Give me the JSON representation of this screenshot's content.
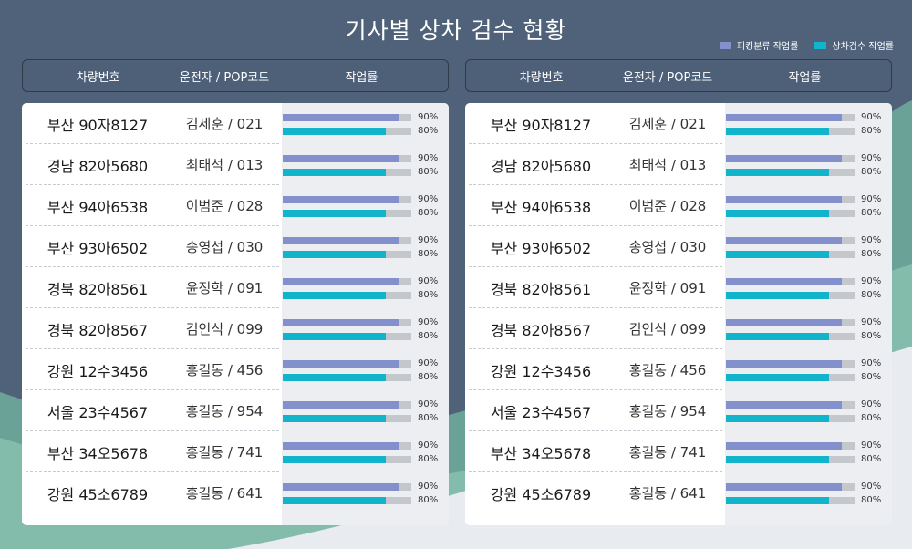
{
  "title": "기사별 상차 검수 현황",
  "legend": {
    "items": [
      {
        "label": "피킹분류 작업률",
        "color": "#8490cc"
      },
      {
        "label": "상차검수 작업률",
        "color": "#12b4cc"
      }
    ]
  },
  "columns": {
    "plate": "차량번호",
    "driver": "운전자 / POP코드",
    "rate": "작업률"
  },
  "panels": [
    {
      "rows": [
        {
          "plate": "부산 90자8127",
          "driver": "김세훈 / 021",
          "picking_pct": 90,
          "inspect_pct": 80,
          "picking_label": "90%",
          "inspect_label": "80%"
        },
        {
          "plate": "경남 82아5680",
          "driver": "최태석 / 013",
          "picking_pct": 90,
          "inspect_pct": 80,
          "picking_label": "90%",
          "inspect_label": "80%"
        },
        {
          "plate": "부산 94아6538",
          "driver": "이범준 / 028",
          "picking_pct": 90,
          "inspect_pct": 80,
          "picking_label": "90%",
          "inspect_label": "80%"
        },
        {
          "plate": "부산 93아6502",
          "driver": "송영섭 / 030",
          "picking_pct": 90,
          "inspect_pct": 80,
          "picking_label": "90%",
          "inspect_label": "80%"
        },
        {
          "plate": "경북 82아8561",
          "driver": "윤정학 / 091",
          "picking_pct": 90,
          "inspect_pct": 80,
          "picking_label": "90%",
          "inspect_label": "80%"
        },
        {
          "plate": "경북 82아8567",
          "driver": "김인식 / 099",
          "picking_pct": 90,
          "inspect_pct": 80,
          "picking_label": "90%",
          "inspect_label": "80%"
        },
        {
          "plate": "강원 12수3456",
          "driver": "홍길동 / 456",
          "picking_pct": 90,
          "inspect_pct": 80,
          "picking_label": "90%",
          "inspect_label": "80%"
        },
        {
          "plate": "서울 23수4567",
          "driver": "홍길동 / 954",
          "picking_pct": 90,
          "inspect_pct": 80,
          "picking_label": "90%",
          "inspect_label": "80%"
        },
        {
          "plate": "부산 34오5678",
          "driver": "홍길동 / 741",
          "picking_pct": 90,
          "inspect_pct": 80,
          "picking_label": "90%",
          "inspect_label": "80%"
        },
        {
          "plate": "강원 45소6789",
          "driver": "홍길동 / 641",
          "picking_pct": 90,
          "inspect_pct": 80,
          "picking_label": "90%",
          "inspect_label": "80%"
        }
      ]
    },
    {
      "rows": [
        {
          "plate": "부산 90자8127",
          "driver": "김세훈 / 021",
          "picking_pct": 90,
          "inspect_pct": 80,
          "picking_label": "90%",
          "inspect_label": "80%"
        },
        {
          "plate": "경남 82아5680",
          "driver": "최태석 / 013",
          "picking_pct": 90,
          "inspect_pct": 80,
          "picking_label": "90%",
          "inspect_label": "80%"
        },
        {
          "plate": "부산 94아6538",
          "driver": "이범준 / 028",
          "picking_pct": 90,
          "inspect_pct": 80,
          "picking_label": "90%",
          "inspect_label": "80%"
        },
        {
          "plate": "부산 93아6502",
          "driver": "송영섭 / 030",
          "picking_pct": 90,
          "inspect_pct": 80,
          "picking_label": "90%",
          "inspect_label": "80%"
        },
        {
          "plate": "경북 82아8561",
          "driver": "윤정학 / 091",
          "picking_pct": 90,
          "inspect_pct": 80,
          "picking_label": "90%",
          "inspect_label": "80%"
        },
        {
          "plate": "경북 82아8567",
          "driver": "김인식 / 099",
          "picking_pct": 90,
          "inspect_pct": 80,
          "picking_label": "90%",
          "inspect_label": "80%"
        },
        {
          "plate": "강원 12수3456",
          "driver": "홍길동 / 456",
          "picking_pct": 90,
          "inspect_pct": 80,
          "picking_label": "90%",
          "inspect_label": "80%"
        },
        {
          "plate": "서울 23수4567",
          "driver": "홍길동 / 954",
          "picking_pct": 90,
          "inspect_pct": 80,
          "picking_label": "90%",
          "inspect_label": "80%"
        },
        {
          "plate": "부산 34오5678",
          "driver": "홍길동 / 741",
          "picking_pct": 90,
          "inspect_pct": 80,
          "picking_label": "90%",
          "inspect_label": "80%"
        },
        {
          "plate": "강원 45소6789",
          "driver": "홍길동 / 641",
          "picking_pct": 90,
          "inspect_pct": 80,
          "picking_label": "90%",
          "inspect_label": "80%"
        }
      ]
    }
  ]
}
